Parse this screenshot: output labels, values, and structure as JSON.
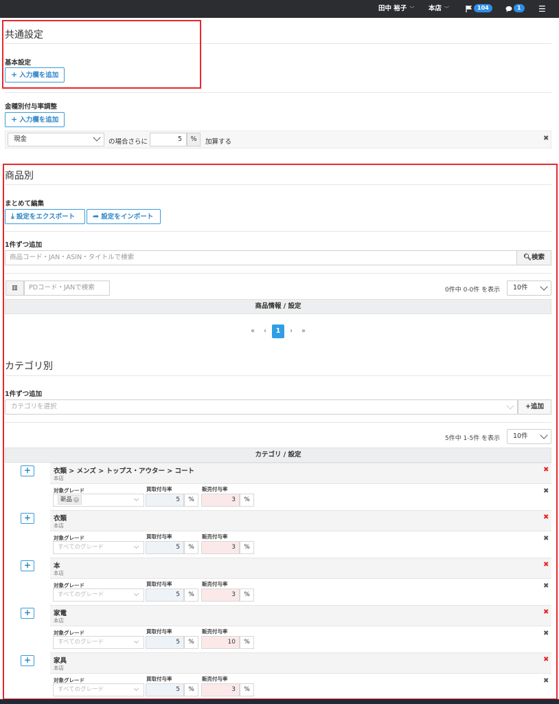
{
  "topbar": {
    "user": "田中 裕子",
    "store": "本店",
    "flag_count": "104",
    "comment_count": "1"
  },
  "common": {
    "title": "共通設定",
    "basic_label": "基本設定",
    "add_btn": "入力欄を追加",
    "type_label": "金種別付与率調整",
    "add_btn2": "入力欄を追加",
    "payment_select": "現金",
    "payment_options": [
      "現金"
    ],
    "mid_text": "の場合さらに",
    "rate_value": "5",
    "rate_unit": "%",
    "tail_text": "加算する"
  },
  "product": {
    "title": "商品別",
    "bulk_label": "まとめて編集",
    "export_btn": "設定をエクスポート",
    "import_btn": "設定をインポート",
    "single_label": "1件ずつ追加",
    "search_placeholder": "商品コード・JAN・ASIN・タイトルで検索",
    "search_btn": "検索",
    "pd_placeholder": "PDコード・JANで検索",
    "count_text": "0件中 0-0件 を表示",
    "per_page": "10件",
    "table_header": "商品情報 / 設定",
    "pager": [
      "«",
      "‹",
      "1",
      "›",
      "»"
    ]
  },
  "category": {
    "title": "カテゴリ別",
    "single_label": "1件ずつ追加",
    "select_placeholder": "カテゴリを選択",
    "add_btn": "追加",
    "count_text": "5件中 1-5件 を表示",
    "per_page": "10件",
    "table_header": "カテゴリ / 設定",
    "field_grade": "対象グレード",
    "field_buy": "買取付与率",
    "field_sell": "販売付与率",
    "unit": "%",
    "rows": [
      {
        "name": "衣類 > メンズ > トップス・アウター > コート",
        "store": "本店",
        "grade": "新品",
        "buy": "5",
        "sell": "3"
      },
      {
        "name": "衣類",
        "store": "本店",
        "grade": "すべてのグレード",
        "buy": "5",
        "sell": "3"
      },
      {
        "name": "本",
        "store": "本店",
        "grade": "すべてのグレード",
        "buy": "5",
        "sell": "3"
      },
      {
        "name": "家電",
        "store": "本店",
        "grade": "すべてのグレード",
        "buy": "5",
        "sell": "10"
      },
      {
        "name": "家具",
        "store": "本店",
        "grade": "すべてのグレード",
        "buy": "5",
        "sell": "3"
      }
    ]
  }
}
